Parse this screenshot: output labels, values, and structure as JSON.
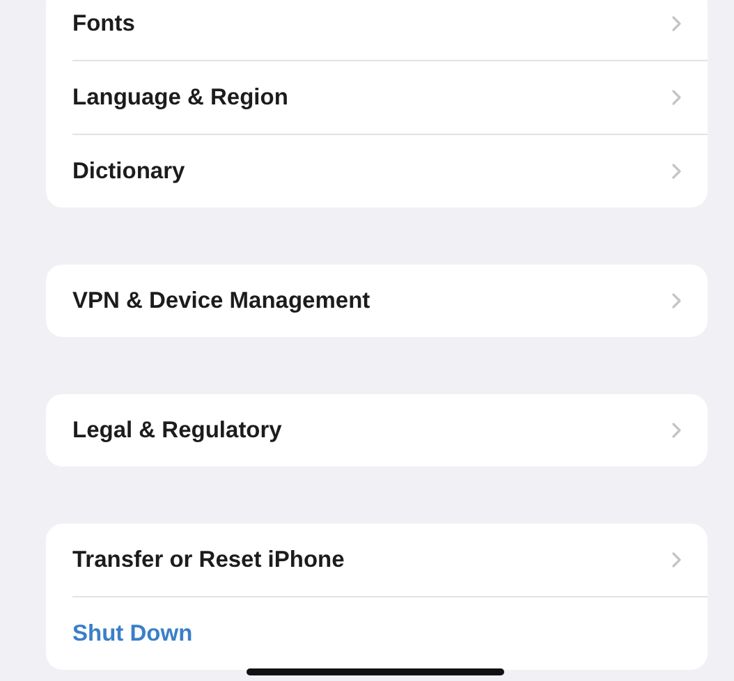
{
  "groups": [
    {
      "rows": [
        {
          "label": "Fonts",
          "kind": "nav"
        },
        {
          "label": "Language & Region",
          "kind": "nav"
        },
        {
          "label": "Dictionary",
          "kind": "nav"
        }
      ]
    },
    {
      "rows": [
        {
          "label": "VPN & Device Management",
          "kind": "nav"
        }
      ]
    },
    {
      "rows": [
        {
          "label": "Legal & Regulatory",
          "kind": "nav"
        }
      ]
    },
    {
      "rows": [
        {
          "label": "Transfer or Reset iPhone",
          "kind": "nav"
        },
        {
          "label": "Shut Down",
          "kind": "action"
        }
      ]
    }
  ]
}
